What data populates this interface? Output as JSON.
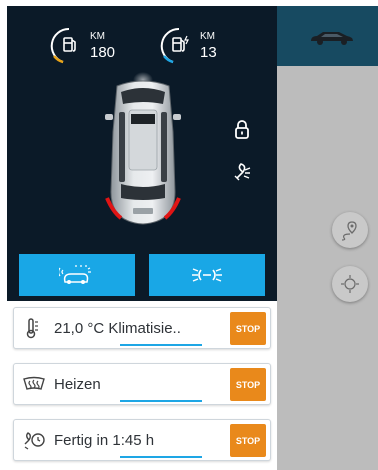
{
  "gauges": {
    "fuel": {
      "unit": "KM",
      "value": "180",
      "icon": "fuel-pump-icon",
      "arc_color": "#e8a317"
    },
    "electric": {
      "unit": "KM",
      "value": "13",
      "icon": "ev-charger-icon",
      "arc_color": "#1ea6e5"
    }
  },
  "vehicle": {
    "lock_icon": "lock-icon",
    "light_icon": "flash-light-icon",
    "car_image": "car-top-view-image"
  },
  "action_buttons": [
    {
      "name": "honk-and-flash-button",
      "icon": "car-horn-lights-icon"
    },
    {
      "name": "flash-lights-button",
      "icon": "headlight-flash-icon"
    }
  ],
  "status_rows": [
    {
      "icon": "thermometer-icon",
      "text": "21,0 °C Klimatisie..",
      "stop_label": "STOP"
    },
    {
      "icon": "windshield-heater-icon",
      "text": "Heizen",
      "stop_label": "STOP"
    },
    {
      "icon": "charge-timer-icon",
      "text": "Fertig in 1:45 h",
      "stop_label": "STOP"
    }
  ],
  "right_panel": {
    "top_icon": "car-side-icon",
    "fab_location": "location-pin-route-icon",
    "fab_center": "crosshair-icon"
  },
  "colors": {
    "accent_blue": "#19a7e6",
    "stop_orange": "#e9891b",
    "dark_bg": "#0b1a28"
  }
}
